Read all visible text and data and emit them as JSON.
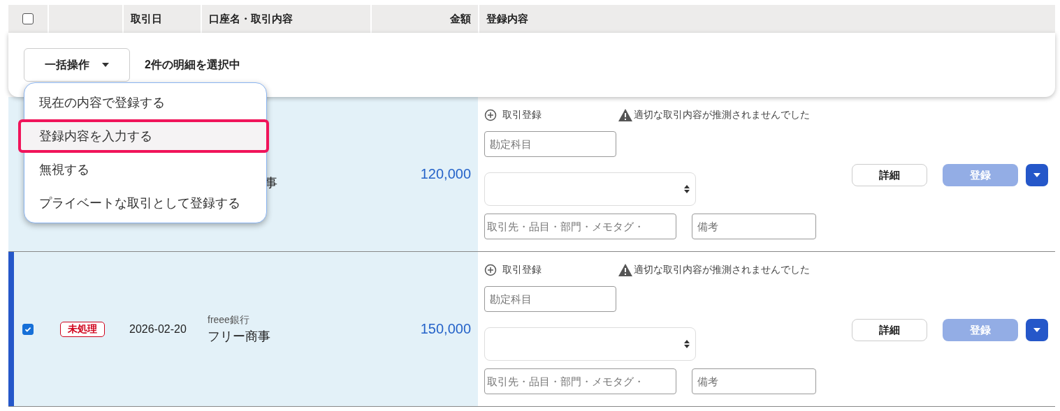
{
  "header": {
    "select_all": {
      "checked": false
    },
    "date": "取引日",
    "account": "口座名・取引内容",
    "amount": "金額",
    "registration": "登録内容"
  },
  "bulk": {
    "button": "一括操作",
    "selection_text": "2件の明細を選択中",
    "menu": [
      {
        "label": "現在の内容で登録する",
        "selected": false
      },
      {
        "label": "登録内容を入力する",
        "selected": true
      },
      {
        "label": "無視する",
        "selected": false
      },
      {
        "label": "プライベートな取引として登録する",
        "selected": false
      }
    ]
  },
  "rows": [
    {
      "kind": "covered",
      "description": "事",
      "amount": "120,000",
      "registration": {
        "add_label": "取引登録",
        "warning": "適切な取引内容が推測されませんでした",
        "account_placeholder": "勘定科目",
        "partner_placeholder": "取引先・品目・部門・メモタグ・",
        "note_placeholder": "備考",
        "detail_button": "詳細",
        "register_button": "登録",
        "register_disabled": true
      }
    },
    {
      "kind": "full",
      "checked": true,
      "status": "未処理",
      "date": "2026-02-20",
      "account": "freee銀行",
      "description": "フリー商事",
      "amount": "150,000",
      "registration": {
        "add_label": "取引登録",
        "warning": "適切な取引内容が推測されませんでした",
        "account_placeholder": "勘定科目",
        "partner_placeholder": "取引先・品目・部門・メモタグ・",
        "note_placeholder": "備考",
        "detail_button": "詳細",
        "register_button": "登録",
        "register_disabled": true
      }
    }
  ]
}
